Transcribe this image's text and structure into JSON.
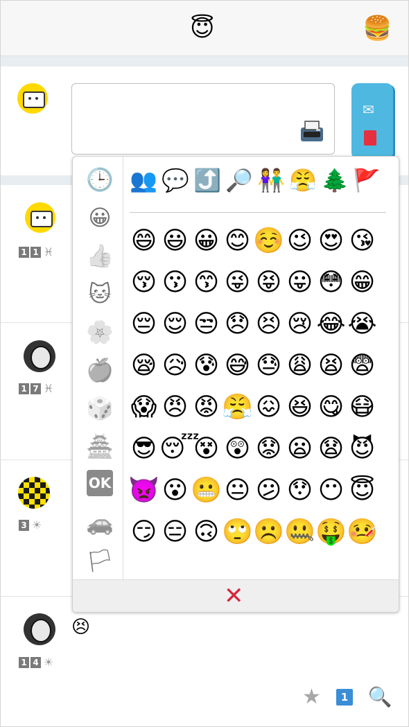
{
  "header": {
    "center_emoji": "😇",
    "right_emoji": "🍔"
  },
  "composer": {
    "text_value": "",
    "fax_icon": "🖷",
    "mail_icon": "✉",
    "post_icon": "postbox-icon"
  },
  "posts": [
    {
      "avatar": "robot-avatar",
      "badge_digits": [
        "1",
        "1"
      ],
      "badge_symbol": "♓"
    },
    {
      "avatar": "alien-avatar",
      "badge_digits": [
        "1",
        "7"
      ],
      "badge_symbol": "♓"
    },
    {
      "avatar": "checker-avatar",
      "badge_digits": [
        "3"
      ],
      "badge_symbol": "☀"
    },
    {
      "avatar": "alien-avatar",
      "badge_digits": [
        "1",
        "4"
      ],
      "badge_symbol": "☀",
      "content_emoji": "😣"
    }
  ],
  "footer": {
    "star": "★",
    "count": "1",
    "search": "🔍"
  },
  "picker": {
    "categories": [
      {
        "name": "recent",
        "glyph": "🕒"
      },
      {
        "name": "smileys",
        "glyph": "😀"
      },
      {
        "name": "people",
        "glyph": "👍"
      },
      {
        "name": "animals",
        "glyph": "🐱"
      },
      {
        "name": "nature",
        "glyph": "🌸"
      },
      {
        "name": "food",
        "glyph": "🍎"
      },
      {
        "name": "activity",
        "glyph": "🎲"
      },
      {
        "name": "places",
        "glyph": "🏯"
      },
      {
        "name": "symbols",
        "glyph": "OK"
      },
      {
        "name": "travel",
        "glyph": "🚗"
      },
      {
        "name": "flags",
        "glyph": "🏳"
      }
    ],
    "recent": [
      "👥",
      "💬",
      "⤴️",
      "🔎",
      "👫",
      "😤",
      "🌲",
      "🚩"
    ],
    "emojis": [
      "😄",
      "😃",
      "😀",
      "😊",
      "☺️",
      "😉",
      "😍",
      "😘",
      "😚",
      "😗",
      "😙",
      "😜",
      "😝",
      "😛",
      "😳",
      "😁",
      "😔",
      "😌",
      "😒",
      "😞",
      "😣",
      "😢",
      "😂",
      "😭",
      "😪",
      "😥",
      "😰",
      "😅",
      "😓",
      "😩",
      "😫",
      "😨",
      "😱",
      "😠",
      "😡",
      "😤",
      "😖",
      "😆",
      "😋",
      "😷",
      "😎",
      "😴",
      "😵",
      "😲",
      "😟",
      "😦",
      "😧",
      "😈",
      "👿",
      "😮",
      "😬",
      "😐",
      "😕",
      "😯",
      "😶",
      "😇",
      "😏",
      "😑",
      "🙃",
      "🙄",
      "☹️",
      "🤐",
      "🤑",
      "🤒"
    ],
    "close_label": "✕"
  }
}
